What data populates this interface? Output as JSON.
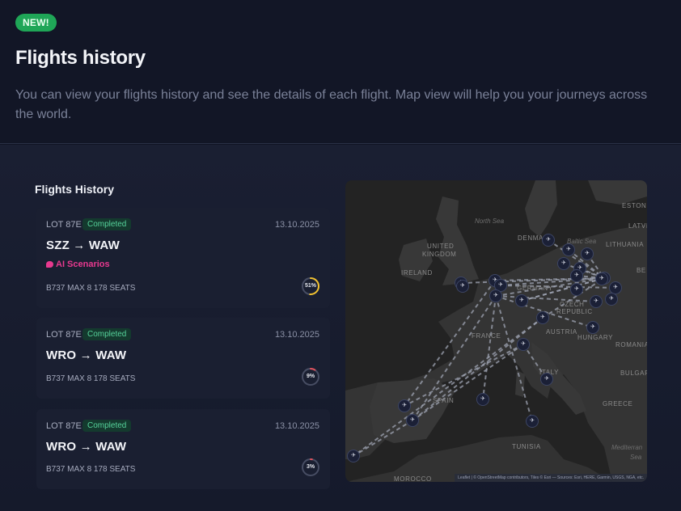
{
  "header": {
    "badge": "NEW!",
    "title": "Flights history",
    "description": "You can view your flights history and see the details of each flight. Map view will help you your journeys across the world."
  },
  "section": {
    "title": "Flights History"
  },
  "flights": [
    {
      "code": "LOT 87E",
      "status": "Completed",
      "date": "13.10.2025",
      "route": "SZZ → WAW",
      "ai_label": "AI Scenarios",
      "aircraft": "B737 MAX 8 178 SEATS",
      "progress_label": "51%",
      "progress": 0.51,
      "progress_color": "#f2c12e"
    },
    {
      "code": "LOT 87E",
      "status": "Completed",
      "date": "13.10.2025",
      "route": "WRO → WAW",
      "aircraft": "B737 MAX 8 178 SEATS",
      "progress_label": "9%",
      "progress": 0.09,
      "progress_color": "#e0525d"
    },
    {
      "code": "LOT 87E",
      "status": "Completed",
      "date": "13.10.2025",
      "route": "WRO → WAW",
      "aircraft": "B737 MAX 8 178 SEATS",
      "progress_label": "3%",
      "progress": 0.03,
      "progress_color": "#e0525d"
    }
  ],
  "map": {
    "labels": {
      "estonia": "ESTONIA",
      "latvia": "LATVIA",
      "lithuania": "LITHUANIA",
      "be": "BE",
      "denmark": "DENMA",
      "uk1": "UNITED",
      "uk2": "KINGDOM",
      "ireland": "IRELAND",
      "germany": "GERMANY",
      "czech1": "CZECH",
      "czech2": "REPUBLIC",
      "austria": "AUSTRIA",
      "hungary": "HUNGARY",
      "romania": "ROMANIA",
      "bulgaria": "BULGAR",
      "france": "FRANCE",
      "italy": "ITALY",
      "spain": "SPAIN",
      "greece": "GREECE",
      "tunisia": "TUNISIA",
      "morocco": "MOROCCO"
    },
    "seas": {
      "north": "North Sea",
      "baltic": "Baltic Sea",
      "med1": "Mediterran",
      "med2": "Sea"
    },
    "marker_glyph": "✈",
    "marker_icon": "airplane-icon",
    "attribution": "Leaflet | © OpenStreetMap contributors, Tiles © Esri — Sources: Esri, HERE, Garmin, USGS, NGA, etc."
  }
}
